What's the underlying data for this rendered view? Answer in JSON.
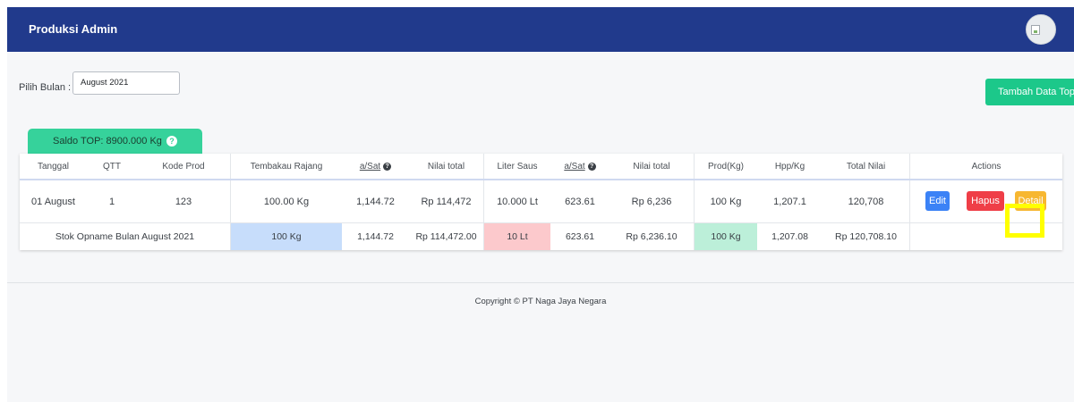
{
  "navbar": {
    "brand": "Produksi Admin",
    "bg_color": "#213a8c",
    "avatar_icon": "broken-image-icon"
  },
  "filter": {
    "label": "Pilih Bulan :",
    "value": "August 2021"
  },
  "add_button": {
    "label": "Tambah Data Top",
    "color": "#1cc88a"
  },
  "saldo": {
    "label": "Saldo TOP: 8900.000 Kg",
    "help_icon": "question-circle-icon",
    "help_glyph": "?"
  },
  "table": {
    "headers": [
      "Tanggal",
      "QTT",
      "Kode Prod",
      "Tembakau Rajang",
      "a/Sat",
      "Nilai total",
      "Liter Saus",
      "a/Sat",
      "Nilai total",
      "Prod(Kg)",
      "Hpp/Kg",
      "Total Nilai",
      "Actions"
    ],
    "rows": [
      {
        "tanggal": "01 August",
        "qtt": "1",
        "kode_prod": "123",
        "tembakau_rajang": "100.00 Kg",
        "a_sat_1": "1,144.72",
        "nilai_total_1": "Rp 114,472",
        "liter_saus": "10.000 Lt",
        "a_sat_2": "623.61",
        "nilai_total_2": "Rp 6,236",
        "prod_kg": "100 Kg",
        "hpp_kg": "1,207.1",
        "total_nilai": "120,708",
        "actions": {
          "edit": "Edit",
          "hapus": "Hapus",
          "detail": "Detail"
        }
      }
    ],
    "summary": {
      "label": "Stok Opname Bulan August 2021",
      "tembakau_rajang": "100 Kg",
      "a_sat_1": "1,144.72",
      "nilai_total_1": "Rp 114,472.00",
      "liter_saus": "10 Lt",
      "a_sat_2": "623.61",
      "nilai_total_2": "Rp 6,236.10",
      "prod_kg": "100 Kg",
      "hpp_kg": "1,207.08",
      "total_nilai": "Rp 120,708.10"
    },
    "colors": {
      "tembakau": "#c7ddfb",
      "saus": "#fcc9cc",
      "prod": "#bcefd9",
      "edit": "#3b82f6",
      "hapus": "#ef3e47",
      "detail": "#f7b731",
      "highlight": "#ffff00"
    }
  },
  "footer": {
    "copyright": "Copyright © PT Naga Jaya Negara"
  }
}
